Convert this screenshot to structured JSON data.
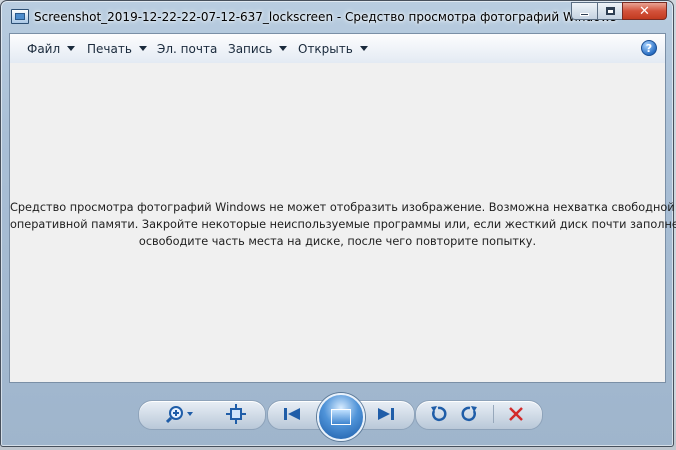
{
  "window": {
    "title": "Screenshot_2019-12-22-22-07-12-637_lockscreen - Средство просмотра фотографий Windows"
  },
  "menu": {
    "items": [
      {
        "label": "Файл",
        "dropdown": true
      },
      {
        "label": "Печать",
        "dropdown": true
      },
      {
        "label": "Эл. почта",
        "dropdown": false
      },
      {
        "label": "Запись",
        "dropdown": true
      },
      {
        "label": "Открыть",
        "dropdown": true
      }
    ],
    "help_glyph": "?"
  },
  "viewer": {
    "message_lines": [
      "Средство просмотра фотографий Windows не может отобразить изображение. Возможна нехватка свободной",
      "оперативной памяти. Закройте некоторые неиспользуемые программы или, если жесткий диск почти заполнен,",
      "освободите часть места на диске, после чего повторите попытку."
    ]
  },
  "controls": {
    "icons": [
      "zoom-icon",
      "fit-to-window-icon",
      "previous-icon",
      "slideshow-icon",
      "next-icon",
      "rotate-left-icon",
      "rotate-right-icon",
      "delete-icon"
    ]
  },
  "colors": {
    "accent": "#2a6fc4",
    "close_button": "#c23a20",
    "delete": "#d32a2a"
  }
}
